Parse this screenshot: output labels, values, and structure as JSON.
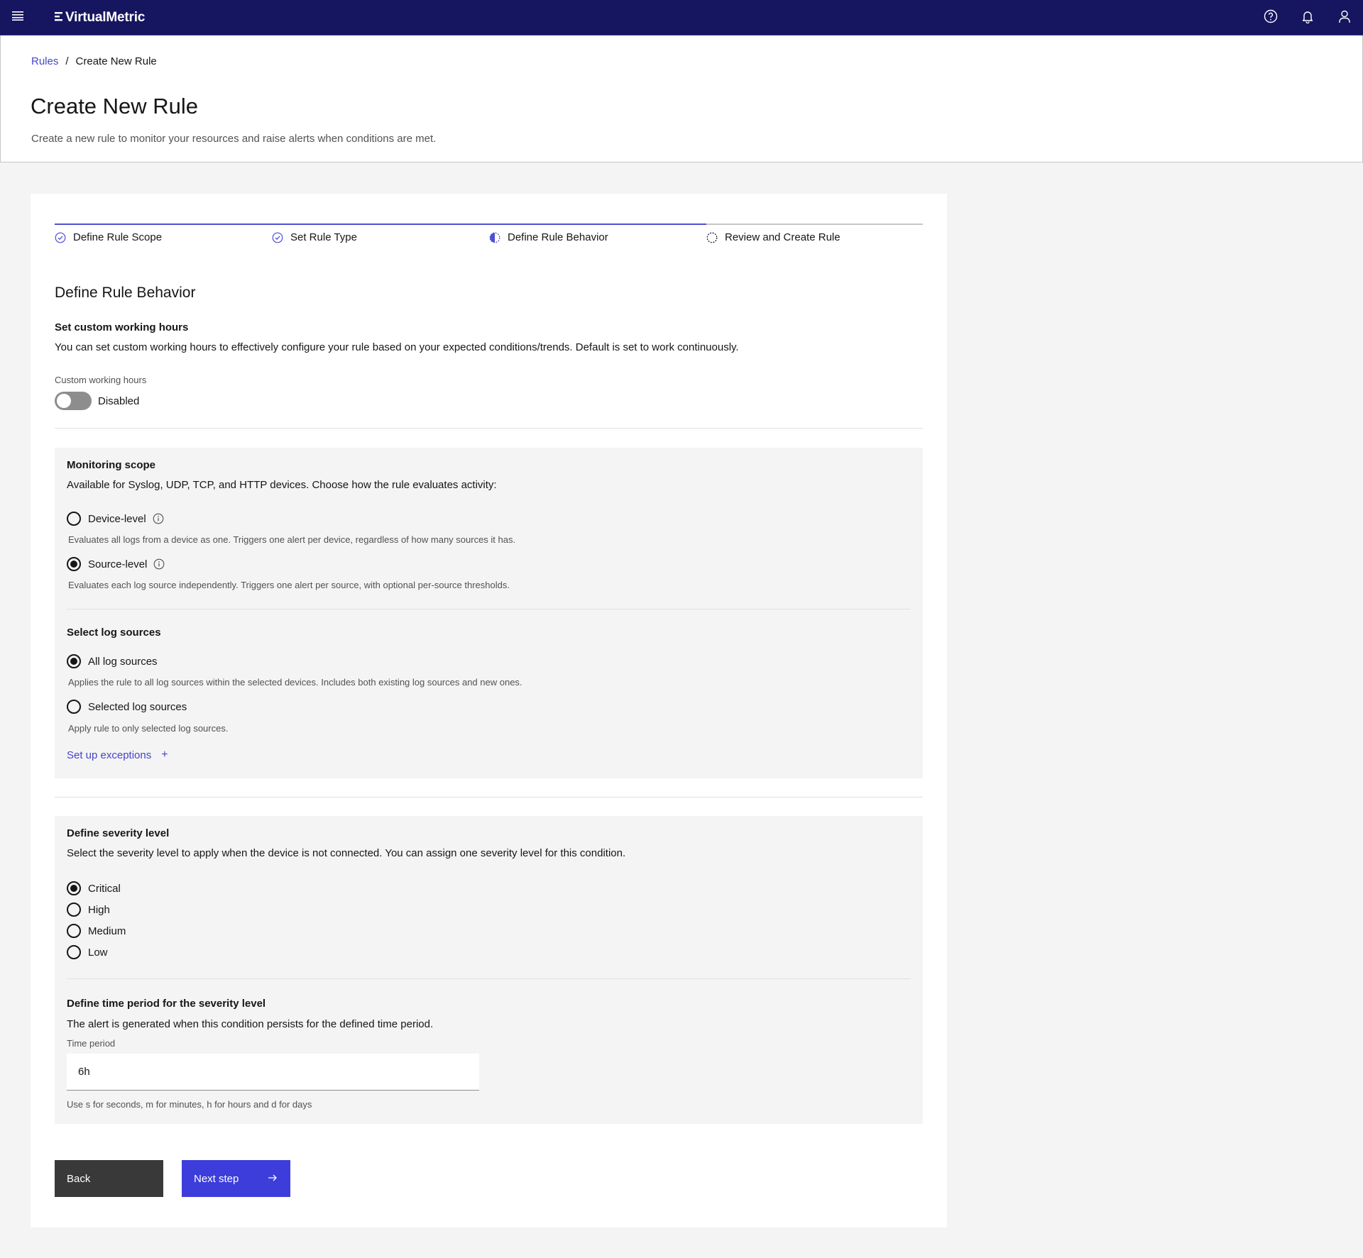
{
  "app": {
    "brand": "VirtualMetric",
    "colors": {
      "topbar": "#16155f",
      "accent": "#4f4ed3",
      "link": "#4544c9",
      "primary_button": "#3d3ddb",
      "secondary_button": "#393939"
    }
  },
  "breadcrumb": {
    "parent": "Rules",
    "separator": "/",
    "current": "Create New Rule"
  },
  "header": {
    "title": "Create New Rule",
    "description": "Create a new rule to monitor your resources and raise alerts when conditions are met."
  },
  "progress": {
    "steps": [
      {
        "label": "Define Rule Scope",
        "state": "complete"
      },
      {
        "label": "Set Rule Type",
        "state": "complete"
      },
      {
        "label": "Define Rule Behavior",
        "state": "current"
      },
      {
        "label": "Review and Create Rule",
        "state": "incomplete"
      }
    ]
  },
  "behavior": {
    "title": "Define Rule Behavior",
    "working_hours": {
      "heading": "Set custom working hours",
      "description": "You can set custom working hours to effectively configure your rule based on your expected conditions/trends. Default is set to work continuously.",
      "toggle_label": "Custom working hours",
      "toggle_state": "Disabled",
      "enabled": false
    },
    "monitoring_scope": {
      "heading": "Monitoring scope",
      "description": "Available for Syslog, UDP, TCP, and HTTP devices. Choose how the rule evaluates activity:",
      "options": [
        {
          "label": "Device-level",
          "helper": "Evaluates all logs from a device as one. Triggers one alert per device, regardless of how many sources it has.",
          "selected": false
        },
        {
          "label": "Source-level",
          "helper": "Evaluates each log source independently. Triggers one alert per source, with optional per-source thresholds.",
          "selected": true
        }
      ]
    },
    "log_sources": {
      "heading": "Select log sources",
      "options": [
        {
          "label": "All log sources",
          "helper": "Applies the rule to all log sources within the selected devices. Includes both existing log sources and new ones.",
          "selected": true
        },
        {
          "label": "Selected log sources",
          "helper": "Apply rule to only selected log sources.",
          "selected": false
        }
      ],
      "exceptions_link": "Set up exceptions",
      "exceptions_icon": "+"
    },
    "severity": {
      "heading": "Define severity level",
      "description": "Select the severity level to apply when the device is not connected. You can assign one severity level for this condition.",
      "options": [
        {
          "label": "Critical",
          "selected": true
        },
        {
          "label": "High",
          "selected": false
        },
        {
          "label": "Medium",
          "selected": false
        },
        {
          "label": "Low",
          "selected": false
        }
      ]
    },
    "time_period": {
      "heading": "Define time period for the severity level",
      "description": "The alert is generated when this condition persists for the defined time period.",
      "field_label": "Time period",
      "value": "6h",
      "helper": "Use s for seconds, m for minutes, h for hours and d for days"
    }
  },
  "actions": {
    "back": "Back",
    "next": "Next step"
  },
  "icons": {
    "menu": "hamburger-menu-icon",
    "help": "help-icon",
    "notifications": "bell-icon",
    "user": "user-icon",
    "info": "info-icon",
    "arrow": "arrow-right-icon"
  }
}
